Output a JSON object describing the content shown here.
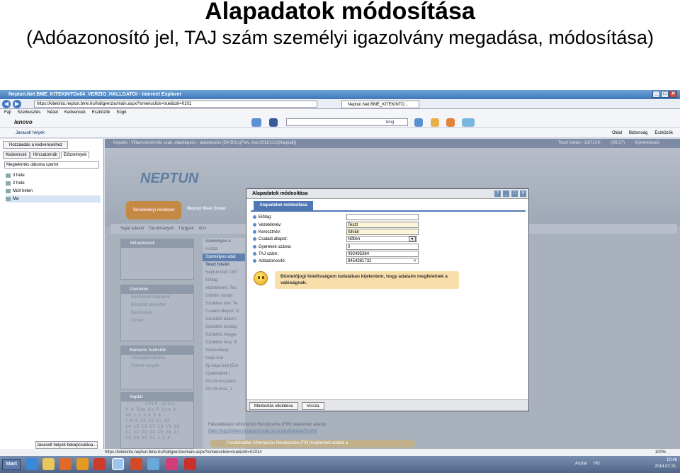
{
  "slide": {
    "title": "Alapadatok módosítása",
    "subtitle": "(Adóazonosító jel, TAJ szám személyi igazolvány megadása, módosítása)"
  },
  "browser": {
    "window_title": "Neptun.Net BME_KITEKINTOx64_VERZIO_HALLGATOI - Internet Explorer",
    "url": "https://kitekinto.neptun.bme.hu/hallgverzio/main.aspx?ismenuclick=true&ctrl=0101",
    "tab_label": "Neptun.Net BME_KITEKINTO...",
    "menu": [
      "Fájl",
      "Szerkesztés",
      "Nézet",
      "Kedvencek",
      "Eszközök",
      "Súgó"
    ],
    "toolbar_brand": "lenovo",
    "search_engine": "bing",
    "fav_bar_item": "Javasolt helyek",
    "commands": [
      "Oldal",
      "Biztonság",
      "Eszközök"
    ],
    "status_url": "https://kitekinto.neptun.bme.hu/hallgverzio/main.aspx?ismenuclick=true&ctrl=0101#",
    "zoom": "100%"
  },
  "favorites_pane": {
    "add_button": "Hozzáadás a kedvencekhez",
    "tabs": [
      "Kedvencek",
      "Hírcsatornák",
      "Előzmények"
    ],
    "sort": "Megtekintés dátuma szerint",
    "items": [
      "3 hete",
      "2 hete",
      "Múlt héten",
      "Ma"
    ],
    "bottom_button": "Javasolt helyek bekapcsolása..."
  },
  "neptun": {
    "topbar": "Képzés : Villamosmérnöki szak, alapképzés - alapképzés (BA/BSc)(Felv. éve:2011/12/1[Nappali])",
    "user": "Teszt István - O871XX",
    "time": "(09:27)",
    "logout": "Kijelentkezés",
    "logo": "NEPTUN",
    "menu_active": "Tanulmányi rendszer",
    "menu_other": "Neptun Meet Street",
    "subnav": [
      "Saját adatok",
      "Tanulmányok",
      "Tárgyak",
      "Vizs"
    ],
    "box_aktualitasok": "Aktualitások",
    "box_uzenetek": "Üzenetek",
    "uzenetek_items": [
      "Beérkezett üzenetek",
      "Elküldött üzenetek",
      "Beállítások",
      "Címtár"
    ],
    "box_kedvenc": "Kedvenc funkciók",
    "kedvenc_items": [
      "Vizsgajelentkezés",
      "Felvett vizsgák"
    ],
    "box_naptar": "Naptár",
    "calendar_month": "2014. július",
    "calendar_head": "H K Sze Cs P Szo V",
    "calendar_rows": [
      "30 1 2 3 4 5 6",
      "7 8 9 10 11 12 13",
      "14 15 16 17 18 19 20",
      "21 22 23 24 25 26 27",
      "28 29 30 31 1 2 3"
    ],
    "panel_header": "Személyes a",
    "panel_crumb": "Hozza",
    "panel_button": "Személyes adat",
    "panel_name": "Teszt István",
    "panel_lines": [
      "Neptun kód: O87",
      "Előtag:",
      "Vezetéknév: Tes",
      "Utónév: István",
      "Születési név: Te",
      "Családi állapot: N",
      "Születési dátum:",
      "Születési ország:",
      "Születési megye:",
      "Születési hely: B",
      "Nemzetiség:",
      "Képz kód",
      "Sp.képz.kód (Exk",
      "Újrafelvételt (",
      "ZV-ről visszaérk.",
      "ZV-ről visza_2"
    ],
    "fir_text": "Felsőoktatási Információs Rendszerbe (FIR) bejelentett adatok",
    "fir_link": "https://ugyintezes.magyarorszag.hu/szolgaltatasok/fir.html",
    "fir_bar": "Felsőoktatási Információs Rendszerbe (FIR) bejelentett adatok a"
  },
  "dialog": {
    "title": "Alapadatok módosítása",
    "tab": "Alapadatok módosítása",
    "fields": [
      {
        "label": "Előtag:",
        "value": ""
      },
      {
        "label": "Vezetéknév:",
        "value": "Teszt"
      },
      {
        "label": "Keresztnév:",
        "value": "István"
      },
      {
        "label": "Családi állapot:",
        "value": "Nőtlen"
      },
      {
        "label": "Gyerekek száma:",
        "value": "0"
      },
      {
        "label": "TAJ szám:",
        "value": "092495384"
      },
      {
        "label": "Adóazonosító:",
        "value": "8454381731"
      }
    ],
    "notice": "Büntetőjogi felelősségem tudatában kijelentem, hogy adataim megfelelnek a valóságnak.",
    "save_button": "Módosítás elküldése",
    "back_button": "Vissza"
  },
  "taskbar": {
    "start": "Start",
    "lang": "HU",
    "desktop": "Asztal",
    "time": "10:46",
    "date": "2014.07.21."
  }
}
